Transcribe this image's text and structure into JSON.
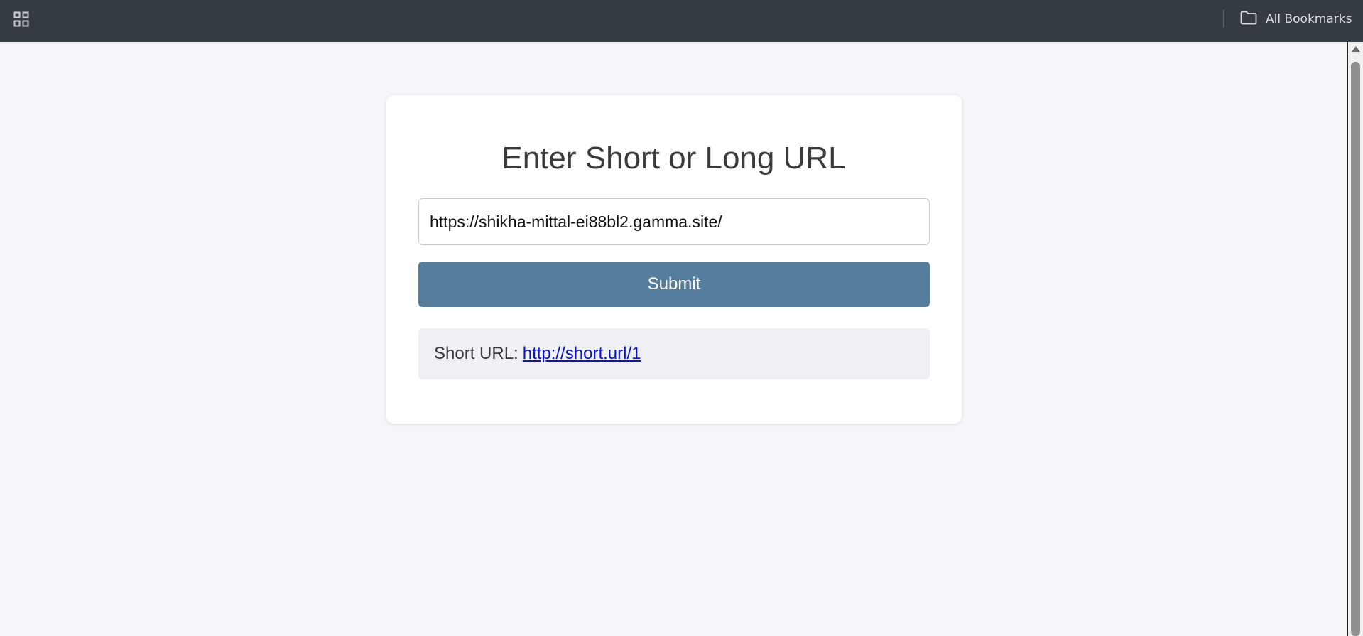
{
  "bookmarks_bar": {
    "apps_icon": "apps-grid-icon",
    "all_bookmarks_icon": "folder-icon",
    "all_bookmarks_label": "All Bookmarks"
  },
  "main": {
    "title": "Enter Short or Long URL",
    "url_input": {
      "value": "https://shikha-mittal-ei88bl2.gamma.site/",
      "placeholder": ""
    },
    "submit_label": "Submit",
    "result": {
      "label": "Short URL:",
      "link_text": "http://short.url/1",
      "link_href": "http://short.url/1"
    }
  },
  "colors": {
    "bookmarks_bar_bg": "#353c41",
    "page_bg": "#f4f6f9",
    "submit_bg": "#557d9c",
    "result_bg": "#eff0f3",
    "link": "#0b12cc"
  }
}
